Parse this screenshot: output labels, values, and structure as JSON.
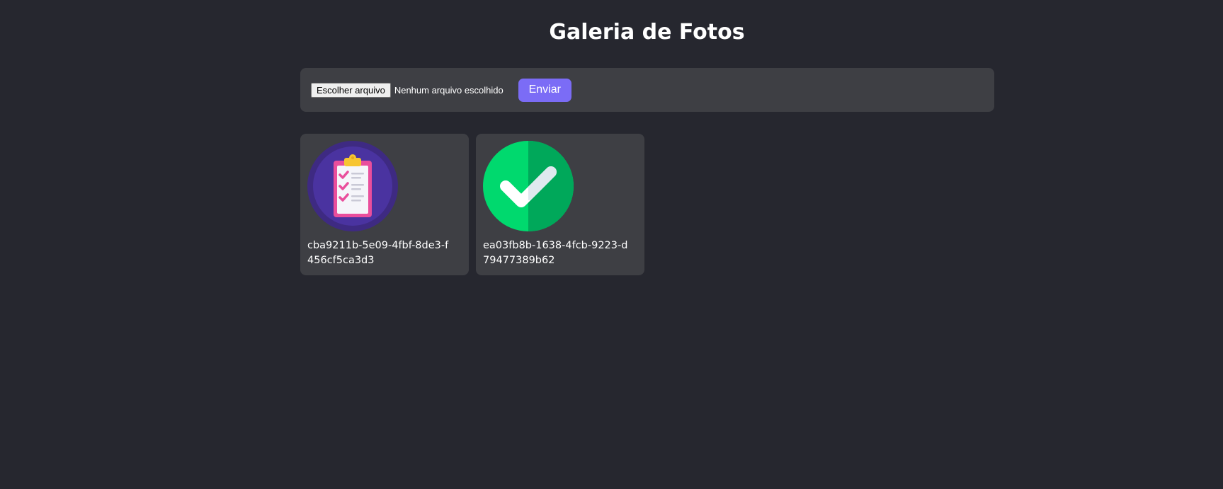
{
  "header": {
    "title": "Galeria de Fotos"
  },
  "upload": {
    "file_button_label": "Escolher arquivo",
    "file_status": "Nenhum arquivo escolhido",
    "submit_label": "Enviar",
    "accent_color": "#7b6cf6"
  },
  "gallery": {
    "photos": [
      {
        "name": "cba9211b-5e09-4fbf-8de3-f456cf5ca3d3",
        "icon": "clipboard-checklist-icon"
      },
      {
        "name": "ea03fb8b-1638-4fcb-9223-d79477389b62",
        "icon": "green-checkmark-icon"
      }
    ]
  },
  "colors": {
    "background": "#26272f",
    "panel": "#3e3f44"
  }
}
